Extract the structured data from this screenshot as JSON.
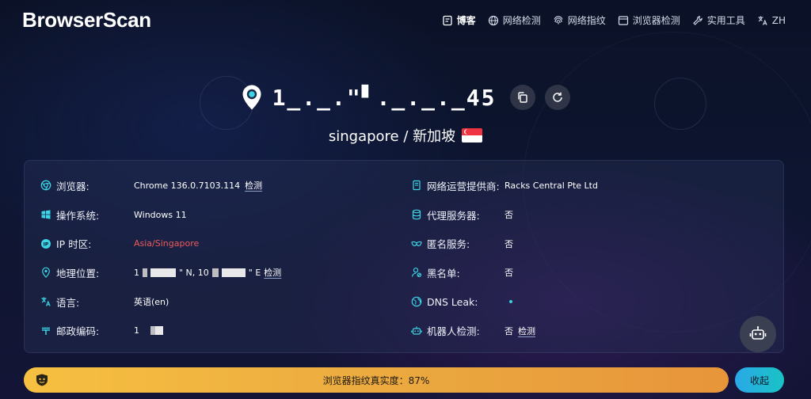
{
  "brand": {
    "logo_text": "BrowserScan"
  },
  "nav": [
    {
      "label": "博客",
      "icon": "blog-icon"
    },
    {
      "label": "网络检测",
      "icon": "globe-icon"
    },
    {
      "label": "网络指纹",
      "icon": "fingerprint-icon"
    },
    {
      "label": "浏览器检测",
      "icon": "browser-window-icon"
    },
    {
      "label": "实用工具",
      "icon": "wrench-icon"
    },
    {
      "label": "ZH",
      "icon": "translate-icon"
    }
  ],
  "hero": {
    "ip": "1_._.\"▘._._._45",
    "location": "singapore / 新加坡"
  },
  "info": {
    "left": [
      {
        "label": "浏览器:",
        "icon": "chrome-icon",
        "value": "Chrome 136.0.7103.114",
        "link": "检测"
      },
      {
        "label": "操作系统:",
        "icon": "windows-icon",
        "value": "Windows 11"
      },
      {
        "label": "IP 时区:",
        "icon": "ip-icon",
        "value": "Asia/Singapore"
      },
      {
        "label": "地理位置:",
        "icon": "location-pin-icon",
        "value_a": "1",
        "value_b": "\" N, 10",
        "value_c": "\" E",
        "link": "检测"
      },
      {
        "label": "语言:",
        "icon": "translate-icon",
        "value": "英语(en)"
      },
      {
        "label": "邮政编码:",
        "icon": "postal-icon",
        "value": "1"
      }
    ],
    "right": [
      {
        "label": "网络运营提供商:",
        "icon": "server-icon",
        "value": "Racks Central Pte Ltd"
      },
      {
        "label": "代理服务器:",
        "icon": "database-icon",
        "value": "否"
      },
      {
        "label": "匿名服务:",
        "icon": "mask-icon",
        "value": "否"
      },
      {
        "label": "黑名单:",
        "icon": "user-block-icon",
        "value": "否"
      },
      {
        "label": "DNS Leak:",
        "icon": "dns-globe-icon",
        "value": ""
      },
      {
        "label": "机器人检测:",
        "icon": "robot-icon",
        "value": "否",
        "link": "检测"
      }
    ]
  },
  "score": {
    "text": "浏览器指纹真实度：87%",
    "percent": 87
  },
  "collapse_label": "收起",
  "colors": {
    "accent_orange": "#f6c041",
    "accent_teal": "#19c3c4",
    "red_value": "#ef5a5a"
  }
}
